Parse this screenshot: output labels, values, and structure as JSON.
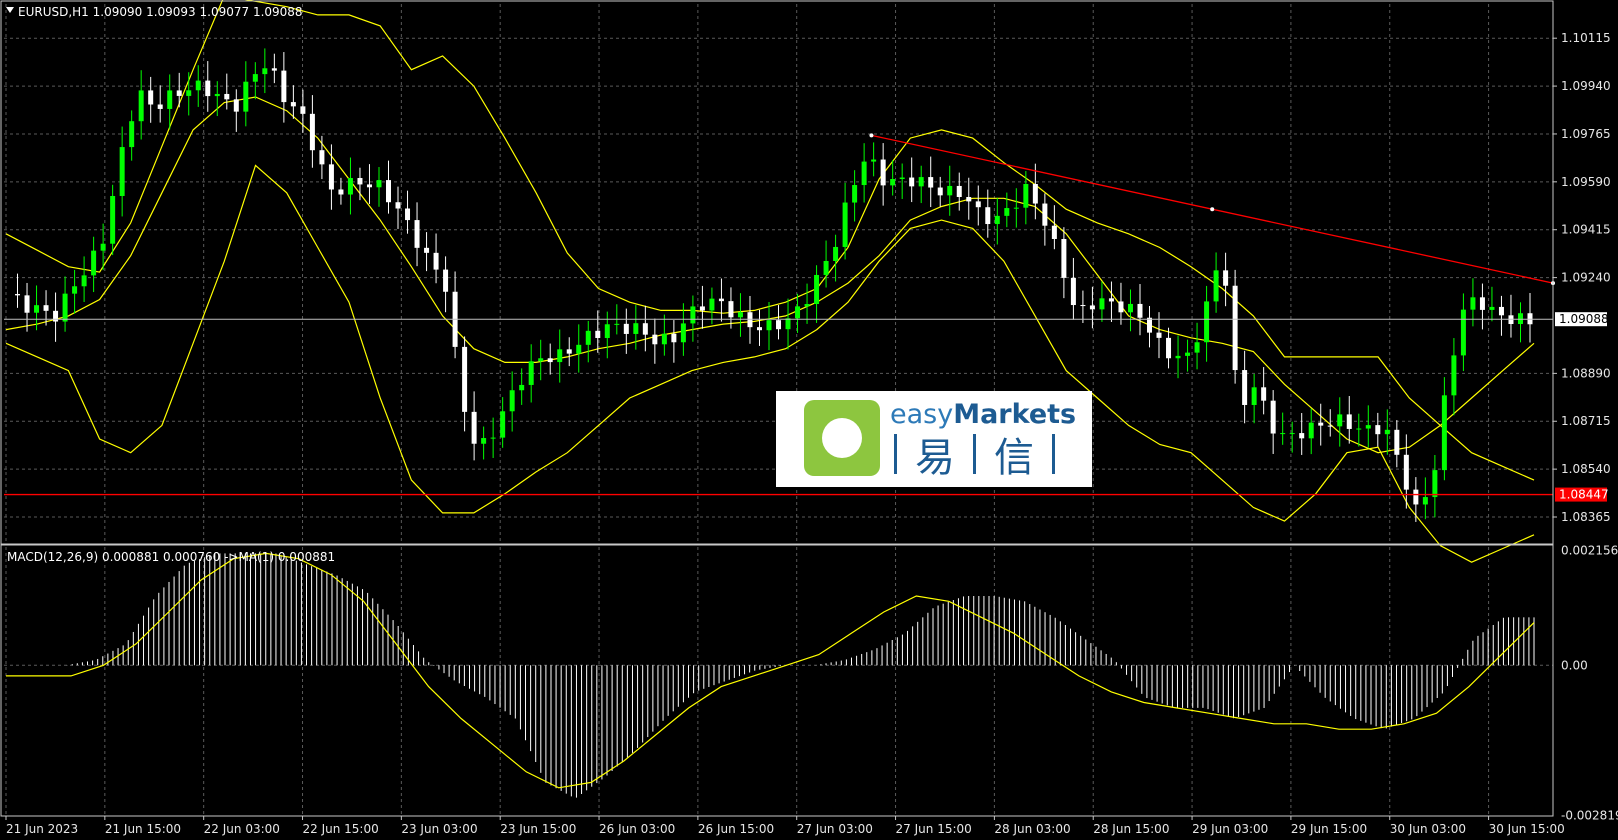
{
  "window": {
    "symbol_line": "EURUSD,H1  1.09090 1.09093 1.09077 1.09088",
    "indicator_line": "MACD(12,26,9) 0.000881 0.000760 ->MA(1) 0.000881"
  },
  "logo": {
    "brand_a": "easy",
    "brand_b": "Markets",
    "cn_a": "易",
    "cn_b": "信"
  },
  "colors": {
    "background": "#000000",
    "grid": "#5a5a5a",
    "frame": "#c8c8c8",
    "bull": "#00ff00",
    "bear": "#ffffff",
    "band": "#ffff00",
    "trendline": "#ff0000",
    "support": "#ff0000",
    "histogram": "#ffffff",
    "signal": "#ffff00"
  },
  "chart_data": [
    {
      "type": "candlestick",
      "title": "EURUSD,H1",
      "ylim": [
        1.0827,
        1.1024
      ],
      "price_ticks": [
        "1.10115",
        "1.09940",
        "1.09765",
        "1.09590",
        "1.09415",
        "1.09240",
        "1.08890",
        "1.08715",
        "1.08540",
        "1.08365"
      ],
      "current_price": "1.09088",
      "support_level": "1.08447",
      "x_ticks": [
        "21 Jun 2023",
        "21 Jun 15:00",
        "22 Jun 03:00",
        "22 Jun 15:00",
        "23 Jun 03:00",
        "23 Jun 15:00",
        "26 Jun 03:00",
        "26 Jun 15:00",
        "27 Jun 03:00",
        "27 Jun 15:00",
        "28 Jun 03:00",
        "28 Jun 15:00",
        "29 Jun 03:00",
        "29 Jun 15:00",
        "30 Jun 03:00",
        "30 Jun 15:00"
      ],
      "close_path": [
        1.0918,
        1.0914,
        1.0912,
        1.091,
        1.0921,
        1.0928,
        1.094,
        1.0969,
        1.0992,
        1.0986,
        1.099,
        1.0993,
        1.0994,
        1.099,
        1.0986,
        1.0997,
        1.1003,
        1.099,
        1.0985,
        1.097,
        1.0955,
        1.0958,
        1.0959,
        1.0957,
        1.095,
        1.094,
        1.093,
        1.0922,
        1.088,
        1.086,
        1.0868,
        1.088,
        1.089,
        1.0895,
        1.0895,
        1.0899,
        1.0903,
        1.0906,
        1.0906,
        1.0905,
        1.0901,
        1.0901,
        1.091,
        1.0915,
        1.0915,
        1.091,
        1.0906,
        1.0906,
        1.0908,
        1.0913,
        1.0924,
        1.0935,
        1.0955,
        1.0969,
        1.096,
        1.0959,
        1.096,
        1.0957,
        1.0955,
        1.0955,
        1.0947,
        1.0945,
        1.095,
        1.0957,
        1.0945,
        1.093,
        1.091,
        1.0915,
        1.0915,
        1.0913,
        1.091,
        1.09,
        1.0895,
        1.0895,
        1.0913,
        1.0935,
        1.0875,
        1.0885,
        1.087,
        1.0865,
        1.0868,
        1.087,
        1.0872,
        1.087,
        1.0868,
        1.087,
        1.0855,
        1.0838,
        1.085,
        1.089,
        1.0915,
        1.0915,
        1.091,
        1.0909,
        1.0908
      ],
      "bollinger": {
        "upper": [
          1.094,
          1.0934,
          1.0928,
          1.0926,
          1.0944,
          1.0972,
          1.1,
          1.1027,
          1.1025,
          1.1023,
          1.102,
          1.102,
          1.1016,
          1.1,
          1.1005,
          1.0994,
          1.0975,
          1.0955,
          1.0933,
          1.092,
          1.0915,
          1.0912,
          1.0912,
          1.0911,
          1.0912,
          1.0915,
          1.092,
          1.0935,
          1.096,
          1.0975,
          1.0978,
          1.0975,
          1.0966,
          1.0958,
          1.0949,
          1.0944,
          1.094,
          1.0935,
          1.0928,
          1.092,
          1.091,
          1.0895,
          1.0895,
          1.0895,
          1.0895,
          1.088,
          1.087,
          1.086,
          1.0855,
          1.085
        ],
        "middle": [
          1.0905,
          1.0907,
          1.091,
          1.0916,
          1.0932,
          1.0955,
          1.0978,
          1.0988,
          1.099,
          1.0985,
          1.0975,
          1.096,
          1.0945,
          1.0928,
          1.091,
          1.0898,
          1.0893,
          1.0893,
          1.0895,
          1.0898,
          1.09,
          1.0903,
          1.0905,
          1.0907,
          1.0908,
          1.091,
          1.0915,
          1.0922,
          1.0932,
          1.0945,
          1.095,
          1.0953,
          1.0953,
          1.095,
          1.094,
          1.0925,
          1.091,
          1.0905,
          1.0902,
          1.09,
          1.0897,
          1.0885,
          1.0875,
          1.0865,
          1.086,
          1.0862,
          1.087,
          1.088,
          1.089,
          1.09
        ],
        "lower": [
          1.09,
          1.0895,
          1.089,
          1.0865,
          1.086,
          1.087,
          1.09,
          1.093,
          1.0965,
          1.0955,
          1.0935,
          1.0915,
          1.088,
          1.085,
          1.0838,
          1.0838,
          1.0845,
          1.0853,
          1.086,
          1.087,
          1.088,
          1.0885,
          1.089,
          1.0893,
          1.0895,
          1.0898,
          1.0905,
          1.0915,
          1.093,
          1.0942,
          1.0945,
          1.0942,
          1.093,
          1.091,
          1.089,
          1.088,
          1.087,
          1.0863,
          1.086,
          1.085,
          1.084,
          1.0835,
          1.0845,
          1.086,
          1.0862,
          1.084,
          1.0826,
          1.082,
          1.0825,
          1.083
        ]
      },
      "trendline": {
        "start": [
          0.56,
          1.0976
        ],
        "end": [
          1.0,
          1.0922
        ]
      }
    },
    {
      "type": "macd_histogram",
      "title": "MACD(12,26,9)",
      "ylim": [
        -0.00283,
        0.00222
      ],
      "y_ticks": [
        "0.002156",
        "0.00",
        "-0.002819"
      ],
      "histogram": [
        0.0,
        0.0,
        0.0,
        0.0001,
        0.0004,
        0.0013,
        0.0019,
        0.0021,
        0.0021,
        0.0021,
        0.0019,
        0.0017,
        0.0014,
        0.0008,
        0.0001,
        -0.0003,
        -0.0006,
        -0.001,
        -0.0022,
        -0.0025,
        -0.0021,
        -0.0016,
        -0.001,
        -0.0005,
        -0.0003,
        -0.0001,
        0.0,
        0.0,
        0.0001,
        0.0003,
        0.0006,
        0.0011,
        0.0013,
        0.0013,
        0.0012,
        0.0009,
        0.0005,
        0.0001,
        -0.0006,
        -0.0008,
        -0.0008,
        -0.001,
        -0.0008,
        0.0,
        -0.0006,
        -0.001,
        -0.0012,
        -0.001,
        -0.0005,
        0.0005,
        0.0009,
        0.0009
      ],
      "signal": [
        -0.0002,
        -0.0002,
        -0.0002,
        0.0,
        0.0004,
        0.001,
        0.0016,
        0.002,
        0.0021,
        0.002,
        0.0017,
        0.0012,
        0.0004,
        -0.0004,
        -0.001,
        -0.0015,
        -0.002,
        -0.0023,
        -0.0022,
        -0.0018,
        -0.0013,
        -0.0008,
        -0.0004,
        -0.0002,
        0.0,
        0.0002,
        0.0006,
        0.001,
        0.0013,
        0.0012,
        0.0009,
        0.0006,
        0.0002,
        -0.0002,
        -0.0005,
        -0.0007,
        -0.0008,
        -0.0009,
        -0.001,
        -0.0011,
        -0.0011,
        -0.0012,
        -0.0012,
        -0.0011,
        -0.0009,
        -0.0004,
        0.0002,
        0.0008
      ]
    }
  ]
}
